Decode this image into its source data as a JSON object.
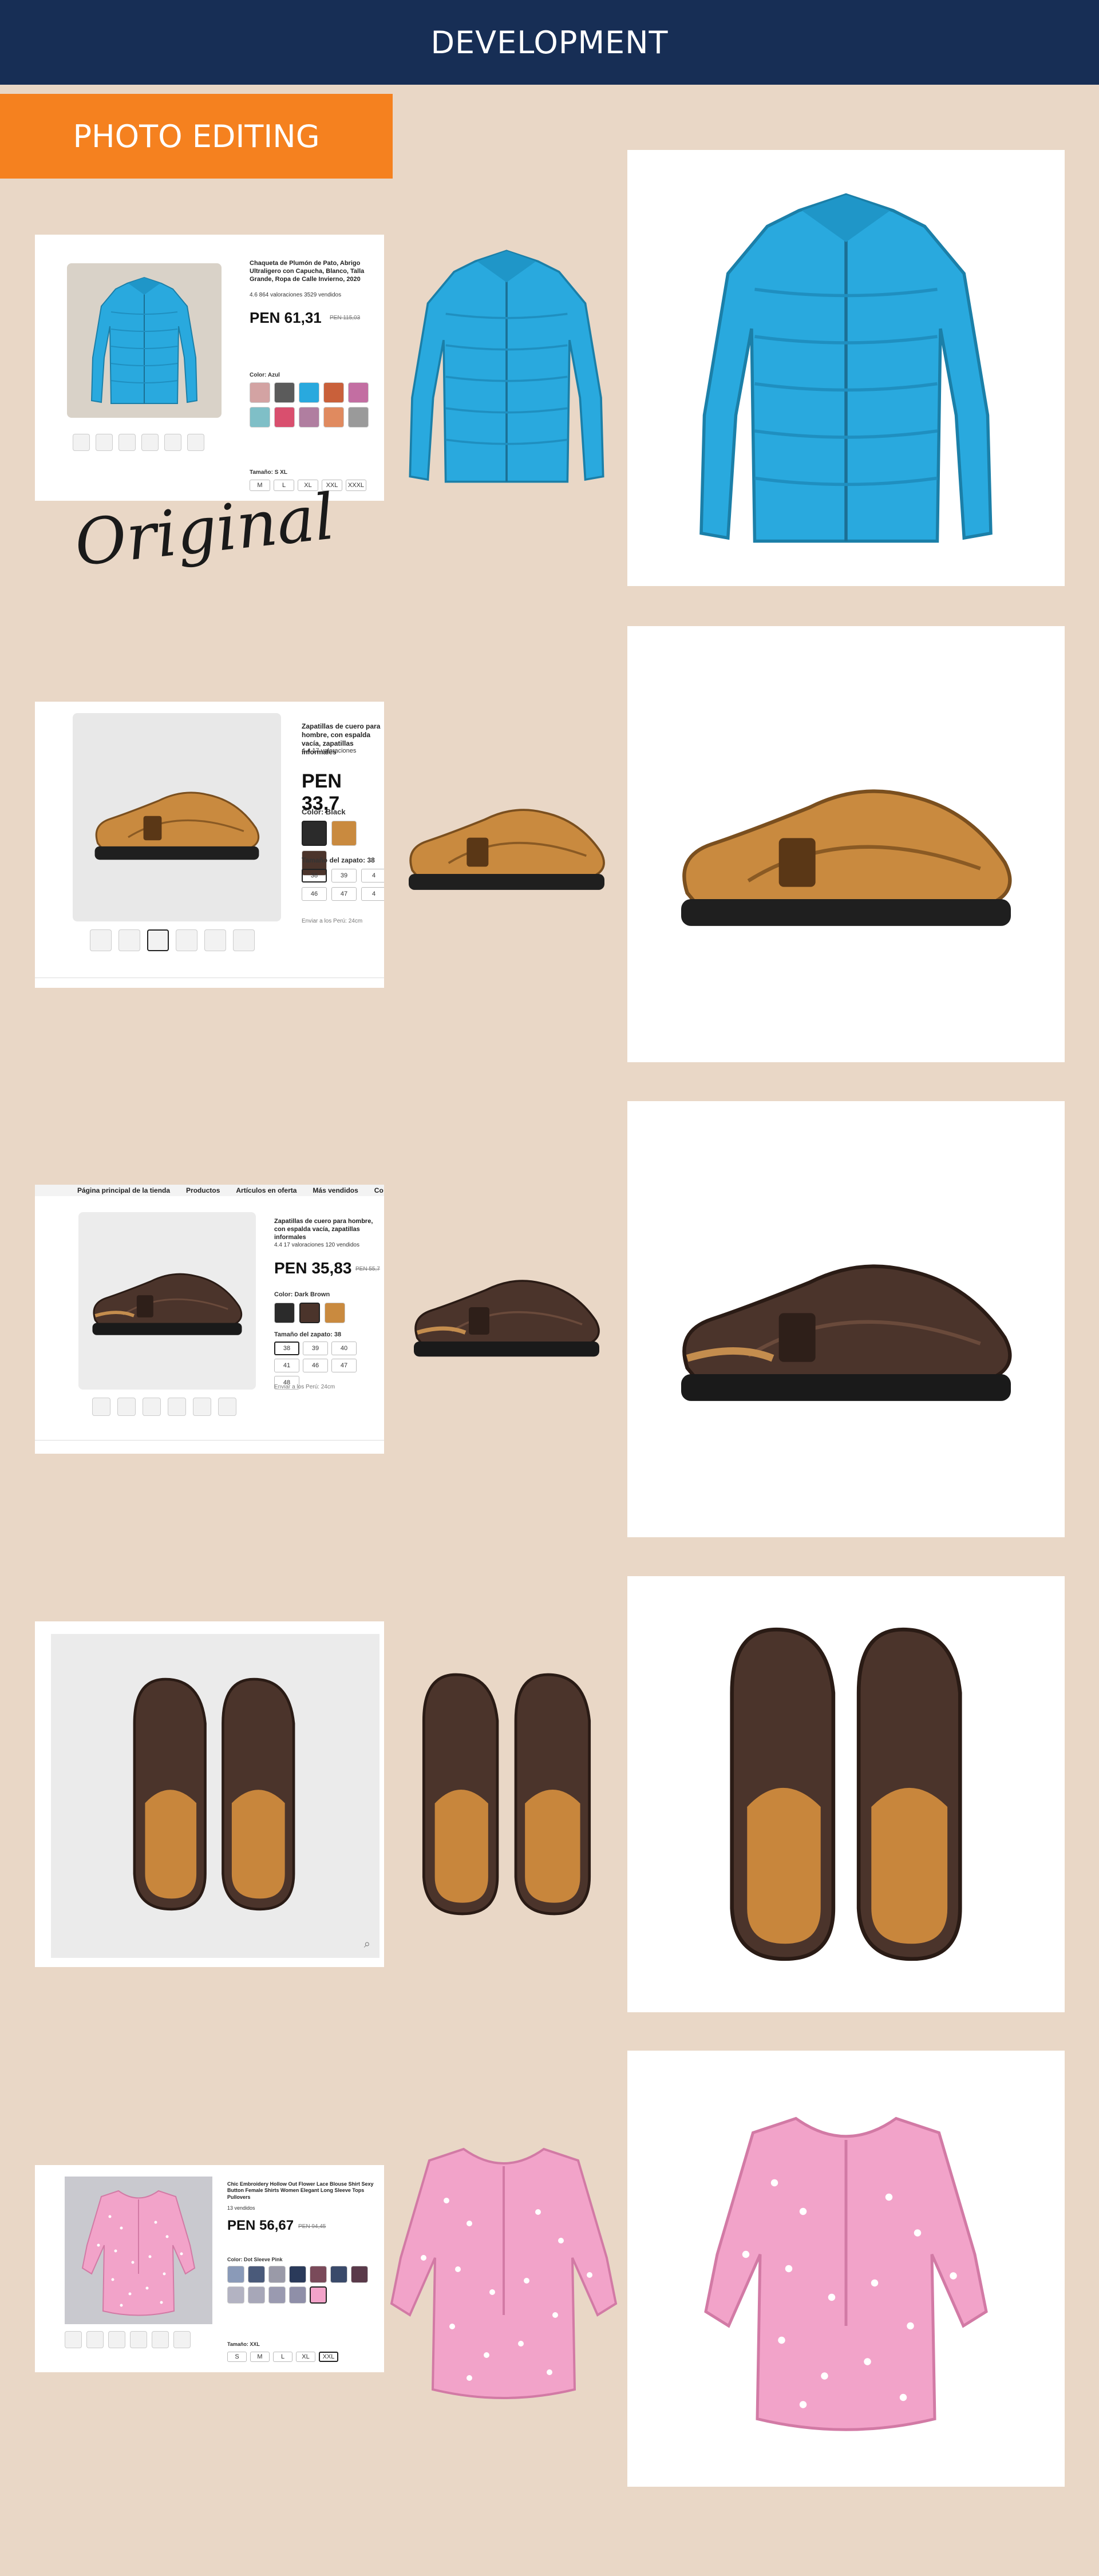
{
  "header": {
    "title": "DEVELOPMENT"
  },
  "section": {
    "badge": "PHOTO EDITING",
    "original_label": "Original"
  },
  "colors": {
    "header_bg": "#172e55",
    "badge_bg": "#f5811f",
    "page_bg": "#e9d7c6",
    "jacket": "#29a9de",
    "shoe_tan": "#c98a3f",
    "shoe_brown": "#4b342b",
    "blouse": "#f2a3c9"
  },
  "rows": [
    {
      "product": "jacket",
      "title": "Chaqueta de Plumón de Pato, Abrigo Ultraligero con Capucha, Blanco, Talla Grande, Ropa de Calle Invierno, 2020",
      "rating": "4.6  864 valoraciones  3529 vendidos",
      "price": "PEN 61,31",
      "old_price": "PEN 115,03",
      "color_label": "Color: Azul",
      "size_label": "Tamaño: S XL",
      "sizes": [
        "M",
        "L",
        "XL",
        "XXL",
        "XXXL"
      ]
    },
    {
      "product": "clog-tan",
      "title": "Zapatillas de cuero para hombre, con espalda vacía, zapatillas informales",
      "rating": "4.4  17 valoraciones",
      "price": "PEN 33,7",
      "color_label": "Color: Black",
      "size_label": "Tamaño del zapato: 38",
      "sizes": [
        "38",
        "39",
        "4",
        "46",
        "47",
        "4"
      ],
      "shipping": "Enviar a los Perú: 24cm"
    },
    {
      "product": "clog-brown",
      "nav": [
        "Página principal de la tienda",
        "Productos",
        "Artículos en oferta",
        "Más vendidos",
        "Co"
      ],
      "title": "Zapatillas de cuero para hombre, con espalda vacía, zapatillas informales",
      "rating": "4.4  17 valoraciones  120 vendidos",
      "price": "PEN 35,83",
      "old_price": "PEN 55,7",
      "color_label": "Color: Dark Brown",
      "size_label": "Tamaño del zapato: 38",
      "sizes": [
        "38",
        "39",
        "40",
        "41",
        "46",
        "47",
        "48"
      ],
      "shipping": "Enviar a los Perú: 24cm"
    },
    {
      "product": "clog-pair-top"
    },
    {
      "product": "blouse",
      "title": "Chic Embroidery Hollow Out Flower Lace Blouse Shirt Sexy Button Female Shirts Women Elegant Long Sleeve Tops Pullovers",
      "sold": "13 vendidos",
      "price": "PEN 56,67",
      "old_price": "PEN 94,45",
      "color_label": "Color: Dot Sleeve Pink",
      "size_label": "Tamaño: XXL",
      "sizes": [
        "S",
        "M",
        "L",
        "XL",
        "XXL"
      ]
    }
  ]
}
